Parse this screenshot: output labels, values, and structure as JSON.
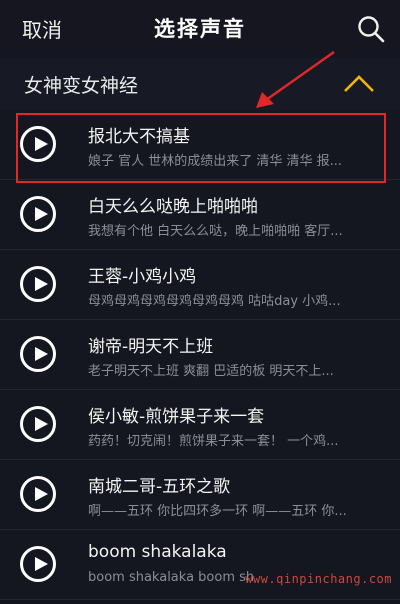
{
  "header": {
    "cancel_label": "取消",
    "title": "选择声音",
    "search_icon": "search-icon"
  },
  "category": {
    "label": "女神变女神经",
    "collapse_icon": "chevron-up-icon",
    "accent_color": "#f2b705"
  },
  "sounds": [
    {
      "name": "报北大不搞基",
      "preview": "娘子 官人 世林的成绩出来了 清华 清华 报..."
    },
    {
      "name": "白天么么哒晚上啪啪啪",
      "preview": "我想有个他 白天么么哒，晚上啪啪啪 客厅..."
    },
    {
      "name": "王蓉-小鸡小鸡",
      "preview": "母鸡母鸡母鸡母鸡母鸡母鸡 咕咕day 小鸡..."
    },
    {
      "name": "谢帝-明天不上班",
      "preview": "老子明天不上班 爽翻 巴适的板 明天不上..."
    },
    {
      "name": "侯小敏-煎饼果子来一套",
      "preview": "药药！切克闹！煎饼果子来一套！ 一个鸡..."
    },
    {
      "name": "南城二哥-五环之歌",
      "preview": "啊——五环 你比四环多一环 啊——五环 你..."
    },
    {
      "name": "boom shakalaka",
      "preview": "boom shakalaka boom sh"
    }
  ],
  "annotation": {
    "highlight_color": "#e02828"
  },
  "watermark": "www.qinpinchang.com"
}
